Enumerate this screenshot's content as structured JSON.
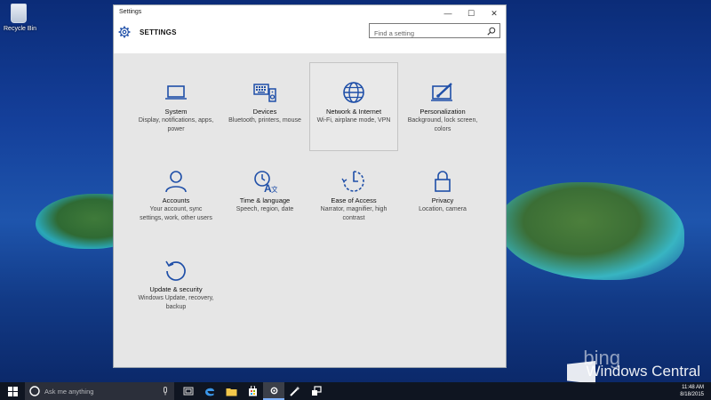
{
  "desktop": {
    "recycle_bin_label": "Recycle Bin",
    "watermark_bing": "bing",
    "watermark_brand": "Windows Central"
  },
  "window": {
    "title": "Settings",
    "controls": {
      "minimize": "—",
      "maximize": "☐",
      "close": "✕"
    },
    "heading": "SETTINGS",
    "search_placeholder": "Find a setting"
  },
  "tiles": [
    {
      "name": "System",
      "desc": "Display, notifications, apps, power",
      "icon": "laptop-icon"
    },
    {
      "name": "Devices",
      "desc": "Bluetooth, printers, mouse",
      "icon": "keyboard-speaker-icon"
    },
    {
      "name": "Network & Internet",
      "desc": "Wi-Fi, airplane mode, VPN",
      "icon": "globe-icon"
    },
    {
      "name": "Personalization",
      "desc": "Background, lock screen, colors",
      "icon": "paintbrush-icon"
    },
    {
      "name": "Accounts",
      "desc": "Your account, sync settings, work, other users",
      "icon": "person-icon"
    },
    {
      "name": "Time & language",
      "desc": "Speech, region, date",
      "icon": "clock-language-icon"
    },
    {
      "name": "Ease of Access",
      "desc": "Narrator, magnifier, high contrast",
      "icon": "ease-of-access-icon"
    },
    {
      "name": "Privacy",
      "desc": "Location, camera",
      "icon": "lock-icon"
    },
    {
      "name": "Update & security",
      "desc": "Windows Update, recovery, backup",
      "icon": "refresh-icon"
    }
  ],
  "taskbar": {
    "search_placeholder": "Ask me anything",
    "tray_time": "11:48 AM",
    "tray_date": "8/18/2015"
  },
  "colors": {
    "accent": "#1f4fa8",
    "window_bg": "#e6e6e6",
    "taskbar_bg": "#10141c"
  }
}
